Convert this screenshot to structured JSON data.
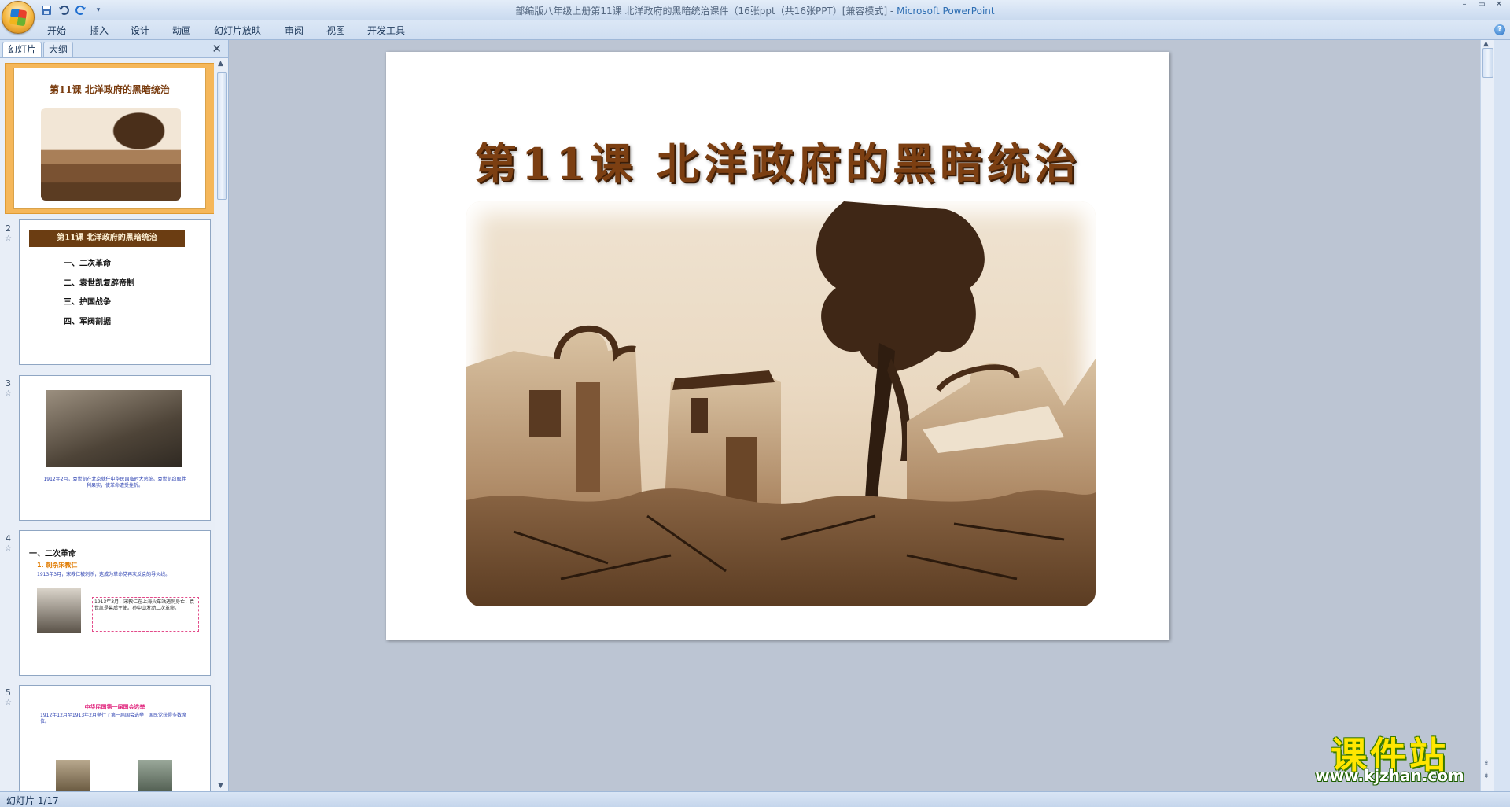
{
  "window": {
    "title": "部编版八年级上册第11课  北洋政府的黑暗统治课件（16张ppt（共16张PPT）[兼容模式] - ",
    "app_name": "Microsoft PowerPoint",
    "controls": {
      "minimize": "–",
      "restore": "▭",
      "close": "✕"
    }
  },
  "quick_access": {
    "save_icon": "save-icon",
    "undo_icon": "undo-icon",
    "redo_icon": "redo-icon",
    "customize": "▾"
  },
  "ribbon": {
    "tabs": [
      "开始",
      "插入",
      "设计",
      "动画",
      "幻灯片放映",
      "审阅",
      "视图",
      "开发工具"
    ],
    "help": "?"
  },
  "panel": {
    "tabs": [
      "幻灯片",
      "大纲"
    ],
    "close": "✕",
    "thumbnails": [
      {
        "num": "1",
        "title": "第11课   北洋政府的黑暗统治"
      },
      {
        "num": "2",
        "title": "第11课 北洋政府的黑暗统治",
        "items": [
          "一、二次革命",
          "二、袁世凯复辟帝制",
          "三、护国战争",
          "四、军阀割据"
        ]
      },
      {
        "num": "3",
        "caption": "1912年2月，袁世凯在北京就任中华民国临时大总统。袁世凯窃取胜利果实，使革命遭受挫折。"
      },
      {
        "num": "4",
        "heading": "一、二次革命",
        "sub": "1. 刺杀宋教仁",
        "body": "1913年3月，宋教仁被刺杀，这成为革命党再次反袁的导火线。",
        "box": "1913年3月，宋教仁在上海火车站遇刺身亡，袁世凯是幕后主使。孙中山发动二次革命。"
      },
      {
        "num": "5",
        "heading": "中华民国第一届国会选举",
        "body": "1912年12月至1913年2月举行了第一届国会选举，国民党获得多数席位。"
      }
    ]
  },
  "slide": {
    "title": "第11课    北洋政府的黑暗统治",
    "image": "ruined-buildings-photo"
  },
  "watermark": {
    "cn": "课件站",
    "url": "www.kjzhan.com"
  },
  "status": {
    "text": "幻灯片 1/17"
  }
}
